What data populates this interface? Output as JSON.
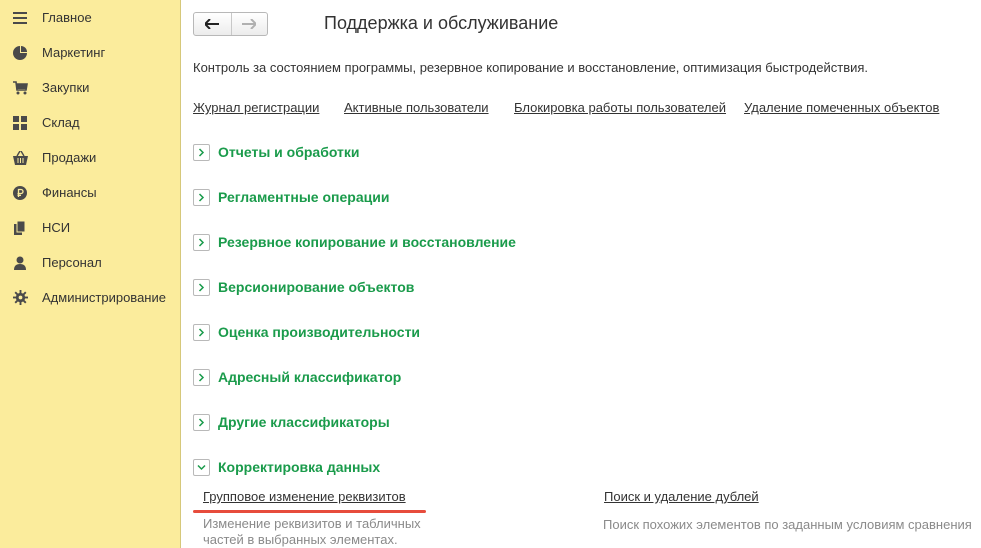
{
  "sidebar": {
    "items": [
      {
        "label": "Главное",
        "icon": "menu-icon"
      },
      {
        "label": "Маркетинг",
        "icon": "pie-chart-icon"
      },
      {
        "label": "Закупки",
        "icon": "cart-icon"
      },
      {
        "label": "Склад",
        "icon": "grid-icon"
      },
      {
        "label": "Продажи",
        "icon": "basket-icon"
      },
      {
        "label": "Финансы",
        "icon": "ruble-icon"
      },
      {
        "label": "НСИ",
        "icon": "books-icon"
      },
      {
        "label": "Персонал",
        "icon": "person-icon"
      },
      {
        "label": "Администрирование",
        "icon": "gear-icon"
      }
    ]
  },
  "header": {
    "title": "Поддержка и обслуживание"
  },
  "main": {
    "description": "Контроль за состоянием программы, резервное копирование и восстановление, оптимизация быстродействия.",
    "links": [
      "Журнал регистрации",
      "Активные пользователи",
      "Блокировка работы пользователей",
      "Удаление помеченных объектов"
    ],
    "sections": [
      {
        "label": "Отчеты и обработки",
        "expanded": false
      },
      {
        "label": "Регламентные операции",
        "expanded": false
      },
      {
        "label": "Резервное копирование и восстановление",
        "expanded": false
      },
      {
        "label": "Версионирование объектов",
        "expanded": false
      },
      {
        "label": "Оценка производительности",
        "expanded": false
      },
      {
        "label": "Адресный классификатор",
        "expanded": false
      },
      {
        "label": "Другие классификаторы",
        "expanded": false
      },
      {
        "label": "Корректировка данных",
        "expanded": true
      }
    ],
    "data_correction": {
      "items": [
        {
          "link": "Групповое изменение реквизитов",
          "desc_line1": "Изменение реквизитов и табличных",
          "desc_line2": "частей в выбранных элементах."
        },
        {
          "link": "Поиск и удаление дублей",
          "desc_line1": "Поиск похожих элементов по заданным условиям сравнения"
        }
      ]
    }
  },
  "colors": {
    "sidebar_bg": "#fbec9c",
    "section_green": "#1a9b4b",
    "highlight_red": "#e74c3c"
  }
}
